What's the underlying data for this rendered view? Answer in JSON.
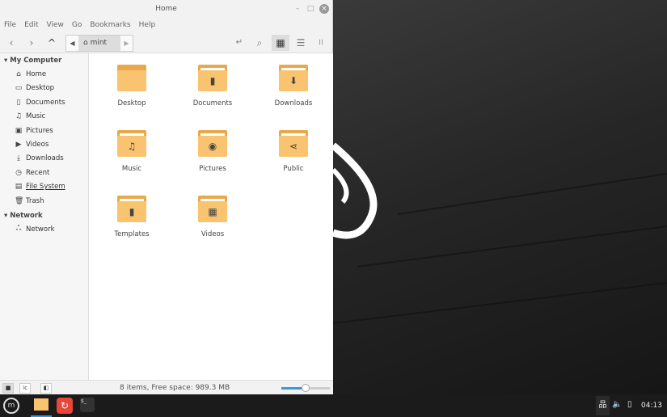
{
  "window": {
    "title": "Home"
  },
  "menu": [
    "File",
    "Edit",
    "View",
    "Go",
    "Bookmarks",
    "Help"
  ],
  "path": {
    "crumb": "mint"
  },
  "sidebar": {
    "sections": [
      {
        "title": "My Computer"
      },
      {
        "title": "Network"
      }
    ],
    "items": [
      {
        "label": "Home",
        "icon": "⌂"
      },
      {
        "label": "Desktop",
        "icon": "▭"
      },
      {
        "label": "Documents",
        "icon": "▯"
      },
      {
        "label": "Music",
        "icon": "♫"
      },
      {
        "label": "Pictures",
        "icon": "▣"
      },
      {
        "label": "Videos",
        "icon": "▶"
      },
      {
        "label": "Downloads",
        "icon": "⤓"
      },
      {
        "label": "Recent",
        "icon": "◷"
      },
      {
        "label": "File System",
        "icon": "▤"
      },
      {
        "label": "Trash",
        "icon": "🗑"
      }
    ],
    "network_items": [
      {
        "label": "Network",
        "icon": "ஃ"
      }
    ]
  },
  "files": [
    {
      "name": "Desktop",
      "glyph": ""
    },
    {
      "name": "Documents",
      "glyph": "▮"
    },
    {
      "name": "Downloads",
      "glyph": "⬇"
    },
    {
      "name": "Music",
      "glyph": "♫"
    },
    {
      "name": "Pictures",
      "glyph": "◉"
    },
    {
      "name": "Public",
      "glyph": "⋖"
    },
    {
      "name": "Templates",
      "glyph": "▮"
    },
    {
      "name": "Videos",
      "glyph": "▦"
    }
  ],
  "status": {
    "text": "8 items, Free space: 989.3 MB",
    "zoom_fraction": 0.5
  },
  "tray": {
    "clock": "04:13"
  },
  "colors": {
    "folder": "#f9c36f",
    "accent": "#3a9ad9"
  }
}
